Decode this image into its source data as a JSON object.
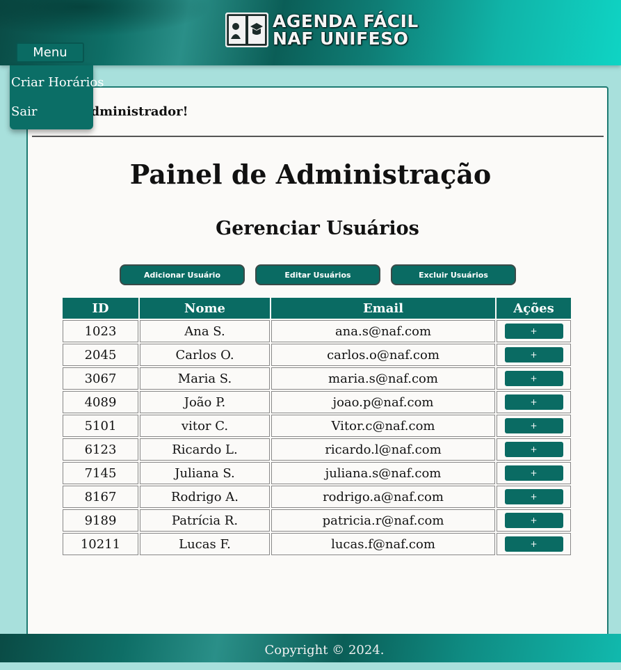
{
  "header": {
    "logo_line1": "AGENDA FÁCIL",
    "logo_line2": "NAF UNIFESO",
    "menu_label": "Menu"
  },
  "menu": {
    "items": [
      {
        "label": "Criar Horários"
      },
      {
        "label": "Sair"
      }
    ]
  },
  "main": {
    "welcome": "o, Administrador!",
    "page_title": "Painel de Administração",
    "section_title": "Gerenciar Usuários",
    "actions": [
      {
        "label": "Adicionar Usuário"
      },
      {
        "label": "Editar Usuários"
      },
      {
        "label": "Excluir Usuários"
      }
    ]
  },
  "table": {
    "headers": [
      "ID",
      "Nome",
      "Email",
      "Ações"
    ],
    "action_label": "+",
    "rows": [
      {
        "id": "1023",
        "nome": "Ana S.",
        "email": "ana.s@naf.com"
      },
      {
        "id": "2045",
        "nome": "Carlos O.",
        "email": "carlos.o@naf.com"
      },
      {
        "id": "3067",
        "nome": "Maria S.",
        "email": "maria.s@naf.com"
      },
      {
        "id": "4089",
        "nome": "João P.",
        "email": "joao.p@naf.com"
      },
      {
        "id": "5101",
        "nome": "vitor C.",
        "email": "Vitor.c@naf.com"
      },
      {
        "id": "6123",
        "nome": "Ricardo L.",
        "email": "ricardo.l@naf.com"
      },
      {
        "id": "7145",
        "nome": "Juliana S.",
        "email": "juliana.s@naf.com"
      },
      {
        "id": "8167",
        "nome": "Rodrigo A.",
        "email": "rodrigo.a@naf.com"
      },
      {
        "id": "9189",
        "nome": "Patrícia R.",
        "email": "patricia.r@naf.com"
      },
      {
        "id": "10211",
        "nome": "Lucas F.",
        "email": "lucas.f@naf.com"
      }
    ]
  },
  "footer": {
    "copyright": "Copyright © 2024."
  },
  "colors": {
    "primary": "#0a6b63",
    "page_background": "#a8e0dc",
    "card_background": "#fbfaf8"
  }
}
